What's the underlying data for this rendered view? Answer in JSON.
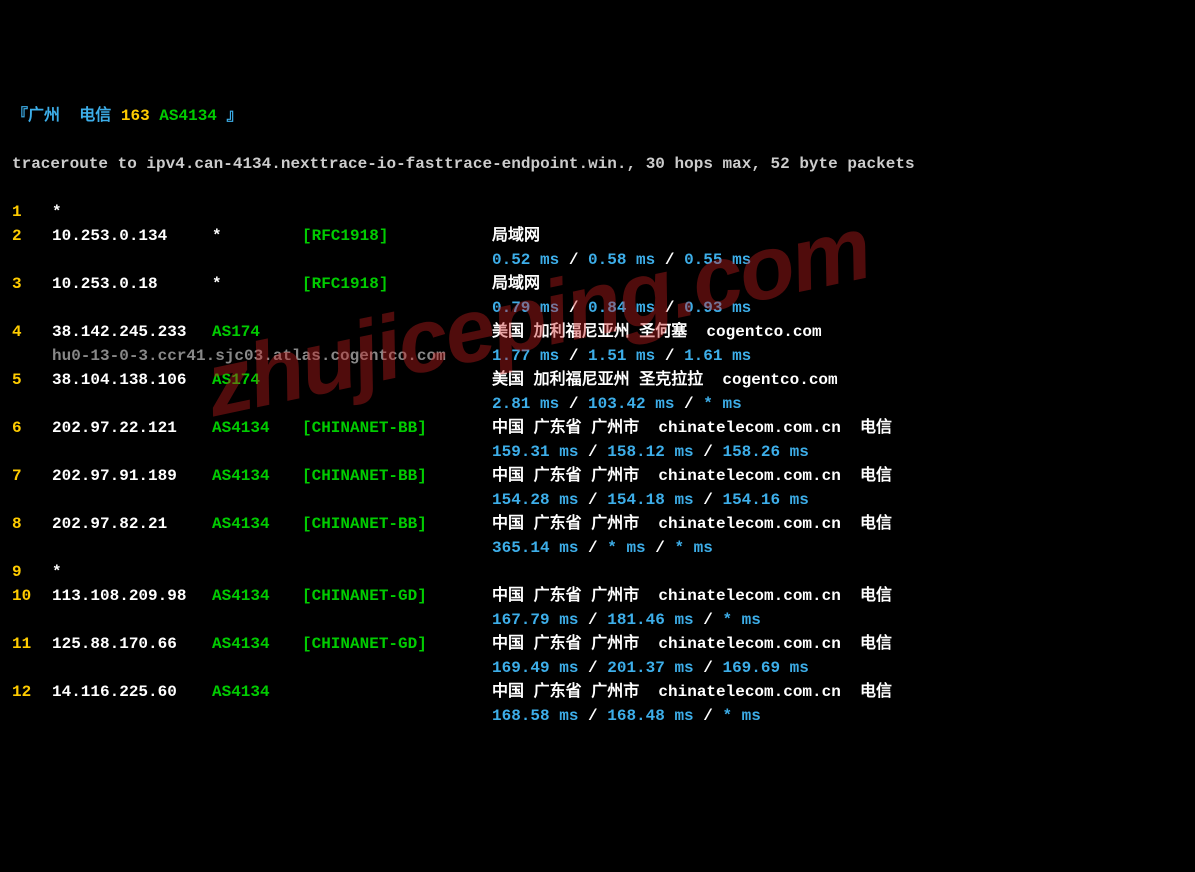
{
  "header": {
    "prefix": "『",
    "location": "广州",
    "isp": "电信",
    "net": "163",
    "asn": "AS4134",
    "suffix": "』"
  },
  "command": "traceroute to ipv4.can-4134.nexttrace-io-fasttrace-endpoint.win., 30 hops max, 52 byte packets",
  "hops": [
    {
      "num": "1",
      "ip": "*",
      "asn": "",
      "tag": "",
      "loc": "",
      "rdns": "",
      "t1": "",
      "t2": "",
      "t3": ""
    },
    {
      "num": "2",
      "ip": "10.253.0.134",
      "asn": "*",
      "asn_plain": true,
      "tag": "[RFC1918]",
      "loc": "局域网",
      "rdns": "",
      "t1": "0.52 ms",
      "t2": "0.58 ms",
      "t3": "0.55 ms"
    },
    {
      "num": "3",
      "ip": "10.253.0.18",
      "asn": "*",
      "asn_plain": true,
      "tag": "[RFC1918]",
      "loc": "局域网",
      "rdns": "",
      "t1": "0.79 ms",
      "t2": "0.84 ms",
      "t3": "0.93 ms"
    },
    {
      "num": "4",
      "ip": "38.142.245.233",
      "asn": "AS174",
      "tag": "",
      "loc": "美国 加利福尼亚州 圣何塞  cogentco.com",
      "rdns": "hu0-13-0-3.ccr41.sjc03.atlas.cogentco.com",
      "t1": "1.77 ms",
      "t2": "1.51 ms",
      "t3": "1.61 ms"
    },
    {
      "num": "5",
      "ip": "38.104.138.106",
      "asn": "AS174",
      "tag": "",
      "loc": "美国 加利福尼亚州 圣克拉拉  cogentco.com",
      "rdns": "",
      "t1": "2.81 ms",
      "t2": "103.42 ms",
      "t3": "* ms"
    },
    {
      "num": "6",
      "ip": "202.97.22.121",
      "asn": "AS4134",
      "tag": "[CHINANET-BB]",
      "loc": "中国 广东省 广州市  chinatelecom.com.cn  电信",
      "rdns": "",
      "t1": "159.31 ms",
      "t2": "158.12 ms",
      "t3": "158.26 ms"
    },
    {
      "num": "7",
      "ip": "202.97.91.189",
      "asn": "AS4134",
      "tag": "[CHINANET-BB]",
      "loc": "中国 广东省 广州市  chinatelecom.com.cn  电信",
      "rdns": "",
      "t1": "154.28 ms",
      "t2": "154.18 ms",
      "t3": "154.16 ms"
    },
    {
      "num": "8",
      "ip": "202.97.82.21",
      "asn": "AS4134",
      "tag": "[CHINANET-BB]",
      "loc": "中国 广东省 广州市  chinatelecom.com.cn  电信",
      "rdns": "",
      "t1": "365.14 ms",
      "t2": "* ms",
      "t3": "* ms"
    },
    {
      "num": "9",
      "ip": "*",
      "asn": "",
      "tag": "",
      "loc": "",
      "rdns": "",
      "t1": "",
      "t2": "",
      "t3": ""
    },
    {
      "num": "10",
      "ip": "113.108.209.98",
      "asn": "AS4134",
      "tag": "[CHINANET-GD]",
      "loc": "中国 广东省 广州市  chinatelecom.com.cn  电信",
      "rdns": "",
      "t1": "167.79 ms",
      "t2": "181.46 ms",
      "t3": "* ms"
    },
    {
      "num": "11",
      "ip": "125.88.170.66",
      "asn": "AS4134",
      "tag": "[CHINANET-GD]",
      "loc": "中国 广东省 广州市  chinatelecom.com.cn  电信",
      "rdns": "",
      "t1": "169.49 ms",
      "t2": "201.37 ms",
      "t3": "169.69 ms"
    },
    {
      "num": "12",
      "ip": "14.116.225.60",
      "asn": "AS4134",
      "tag": "",
      "loc": "中国 广东省 广州市  chinatelecom.com.cn  电信",
      "rdns": "",
      "t1": "168.58 ms",
      "t2": "168.48 ms",
      "t3": "* ms"
    }
  ],
  "separator": " / ",
  "watermark": "zhujiceping.com"
}
